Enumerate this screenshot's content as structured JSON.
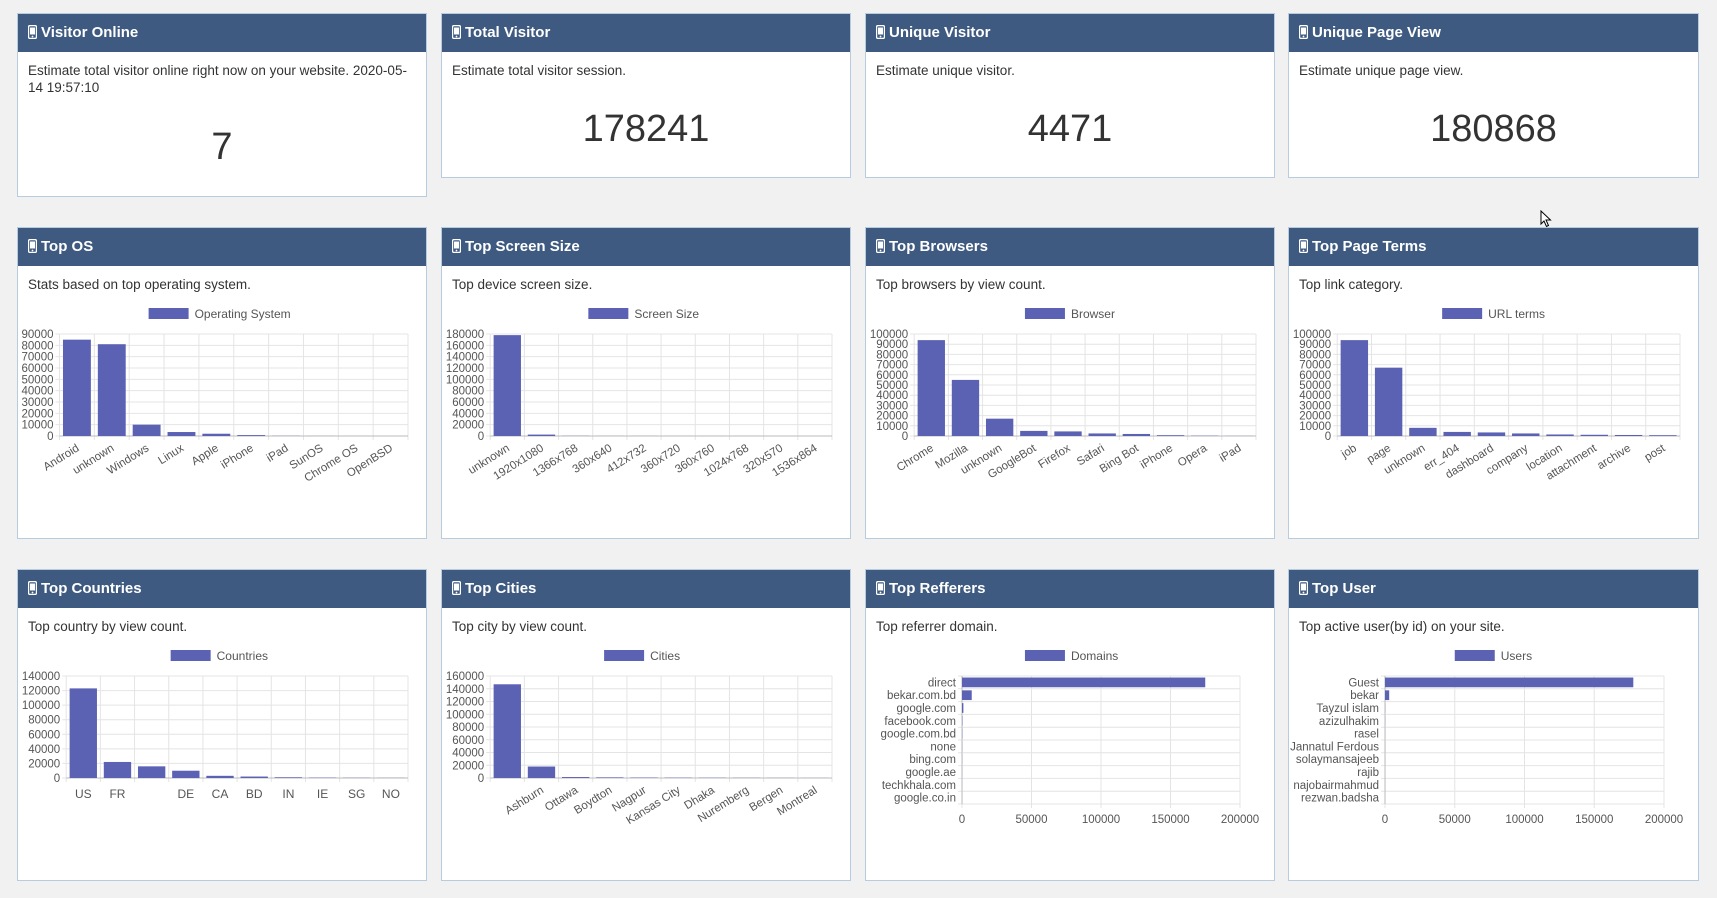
{
  "colors": {
    "header_bg": "#3e5a80",
    "bar": "#5b62b4",
    "grid": "#e4e4e4",
    "border": "#b8cce0"
  },
  "stats": [
    {
      "title": "Visitor Online",
      "icon": "mobile-icon",
      "description": "Estimate total visitor online right now on your website. 2020-05-14 19:57:10",
      "value": "7"
    },
    {
      "title": "Total Visitor",
      "icon": "mobile-icon",
      "description": "Estimate total visitor session.",
      "value": "178241"
    },
    {
      "title": "Unique Visitor",
      "icon": "mobile-icon",
      "description": "Estimate unique visitor.",
      "value": "4471"
    },
    {
      "title": "Unique Page View",
      "icon": "mobile-icon",
      "description": "Estimate unique page view.",
      "value": "180868"
    }
  ],
  "charts": [
    {
      "title": "Top OS",
      "icon": "mobile-icon",
      "description": "Stats based on top operating system."
    },
    {
      "title": "Top Screen Size",
      "icon": "mobile-icon",
      "description": "Top device screen size."
    },
    {
      "title": "Top Browsers",
      "icon": "mobile-icon",
      "description": "Top browsers by view count."
    },
    {
      "title": "Top Page Terms",
      "icon": "mobile-icon",
      "description": "Top link category."
    },
    {
      "title": "Top Countries",
      "icon": "mobile-icon",
      "description": "Top country by view count."
    },
    {
      "title": "Top Cities",
      "icon": "mobile-icon",
      "description": "Top city by view count."
    },
    {
      "title": "Top Refferers",
      "icon": "mobile-icon",
      "description": "Top referrer domain."
    },
    {
      "title": "Top User",
      "icon": "mobile-icon",
      "description": "Top active user(by id) on your site."
    }
  ],
  "chart_data": [
    {
      "type": "bar",
      "orientation": "vertical",
      "legend": "Operating System",
      "legend_position": "top",
      "grid": true,
      "categories": [
        "Android",
        "unknown",
        "Windows",
        "Linux",
        "Apple",
        "iPhone",
        "iPad",
        "SunOS",
        "Chrome OS",
        "OpenBSD"
      ],
      "values": [
        85000,
        81000,
        10000,
        3500,
        2000,
        800,
        150,
        50,
        30,
        10
      ],
      "ylim": [
        0,
        90000
      ],
      "yticks": [
        0,
        10000,
        20000,
        30000,
        40000,
        50000,
        60000,
        70000,
        80000,
        90000
      ],
      "rotate_labels": true
    },
    {
      "type": "bar",
      "orientation": "vertical",
      "legend": "Screen Size",
      "legend_position": "top",
      "grid": true,
      "categories": [
        "unknown",
        "1920x1080",
        "1366x768",
        "360x640",
        "412x732",
        "360x720",
        "360x760",
        "1024x768",
        "320x570",
        "1536x864"
      ],
      "values": [
        178000,
        2500,
        300,
        100,
        80,
        60,
        50,
        40,
        30,
        20
      ],
      "ylim": [
        0,
        180000
      ],
      "yticks": [
        0,
        20000,
        40000,
        60000,
        80000,
        100000,
        120000,
        140000,
        160000,
        180000
      ],
      "rotate_labels": true
    },
    {
      "type": "bar",
      "orientation": "vertical",
      "legend": "Browser",
      "legend_position": "top",
      "grid": true,
      "categories": [
        "Chrome",
        "Mozilla",
        "unknown",
        "GoogleBot",
        "Firefox",
        "Safari",
        "Bing Bot",
        "iPhone",
        "Opera",
        "iPad"
      ],
      "values": [
        94000,
        55000,
        17000,
        5000,
        4500,
        2500,
        2000,
        800,
        300,
        100
      ],
      "ylim": [
        0,
        100000
      ],
      "yticks": [
        0,
        10000,
        20000,
        30000,
        40000,
        50000,
        60000,
        70000,
        80000,
        90000,
        100000
      ],
      "rotate_labels": true
    },
    {
      "type": "bar",
      "orientation": "vertical",
      "legend": "URL terms",
      "legend_position": "top",
      "grid": true,
      "categories": [
        "job",
        "page",
        "unknown",
        "err_404",
        "dashboard",
        "company",
        "location",
        "attachment",
        "archive",
        "post"
      ],
      "values": [
        94000,
        67000,
        8000,
        4000,
        3500,
        2500,
        1500,
        1200,
        1000,
        800
      ],
      "ylim": [
        0,
        100000
      ],
      "yticks": [
        0,
        10000,
        20000,
        30000,
        40000,
        50000,
        60000,
        70000,
        80000,
        90000,
        100000
      ],
      "rotate_labels": true
    },
    {
      "type": "bar",
      "orientation": "vertical",
      "legend": "Countries",
      "legend_position": "top",
      "grid": true,
      "categories": [
        "US",
        "FR",
        "",
        "DE",
        "CA",
        "BD",
        "IN",
        "IE",
        "SG",
        "NO"
      ],
      "values": [
        123000,
        22000,
        16000,
        10000,
        3000,
        2000,
        1000,
        500,
        300,
        200
      ],
      "ylim": [
        0,
        140000
      ],
      "yticks": [
        0,
        20000,
        40000,
        60000,
        80000,
        100000,
        120000,
        140000
      ],
      "rotate_labels": false
    },
    {
      "type": "bar",
      "orientation": "vertical",
      "legend": "Cities",
      "legend_position": "top",
      "grid": true,
      "categories": [
        "",
        "Ashburn",
        "Ottawa",
        "Boydton",
        "Nagpur",
        "Kansas City",
        "Dhaka",
        "Nuremberg",
        "Bergen",
        "Montreal"
      ],
      "values": [
        147000,
        18000,
        1500,
        1000,
        700,
        500,
        400,
        300,
        200,
        100
      ],
      "ylim": [
        0,
        160000
      ],
      "yticks": [
        0,
        20000,
        40000,
        60000,
        80000,
        100000,
        120000,
        140000,
        160000
      ],
      "rotate_labels": true
    },
    {
      "type": "bar",
      "orientation": "horizontal",
      "legend": "Domains",
      "legend_position": "top",
      "grid": true,
      "categories": [
        "direct",
        "bekar.com.bd",
        "google.com",
        "facebook.com",
        "google.com.bd",
        "none",
        "bing.com",
        "google.ae",
        "techkhala.com",
        "google.co.in"
      ],
      "values": [
        175000,
        7000,
        1000,
        300,
        200,
        100,
        80,
        50,
        30,
        20
      ],
      "xlim": [
        0,
        200000
      ],
      "xticks": [
        0,
        50000,
        100000,
        150000,
        200000
      ]
    },
    {
      "type": "bar",
      "orientation": "horizontal",
      "legend": "Users",
      "legend_position": "top",
      "grid": true,
      "categories": [
        "Guest",
        "bekar",
        "Tayzul islam",
        "azizulhakim",
        "rasel",
        "Jannatul Ferdous",
        "solaymansajeeb",
        "rajib",
        "najobairmahmud",
        "rezwan.badsha"
      ],
      "values": [
        178000,
        3000,
        100,
        80,
        60,
        50,
        40,
        30,
        20,
        10
      ],
      "xlim": [
        0,
        200000
      ],
      "xticks": [
        0,
        50000,
        100000,
        150000,
        200000
      ]
    }
  ]
}
